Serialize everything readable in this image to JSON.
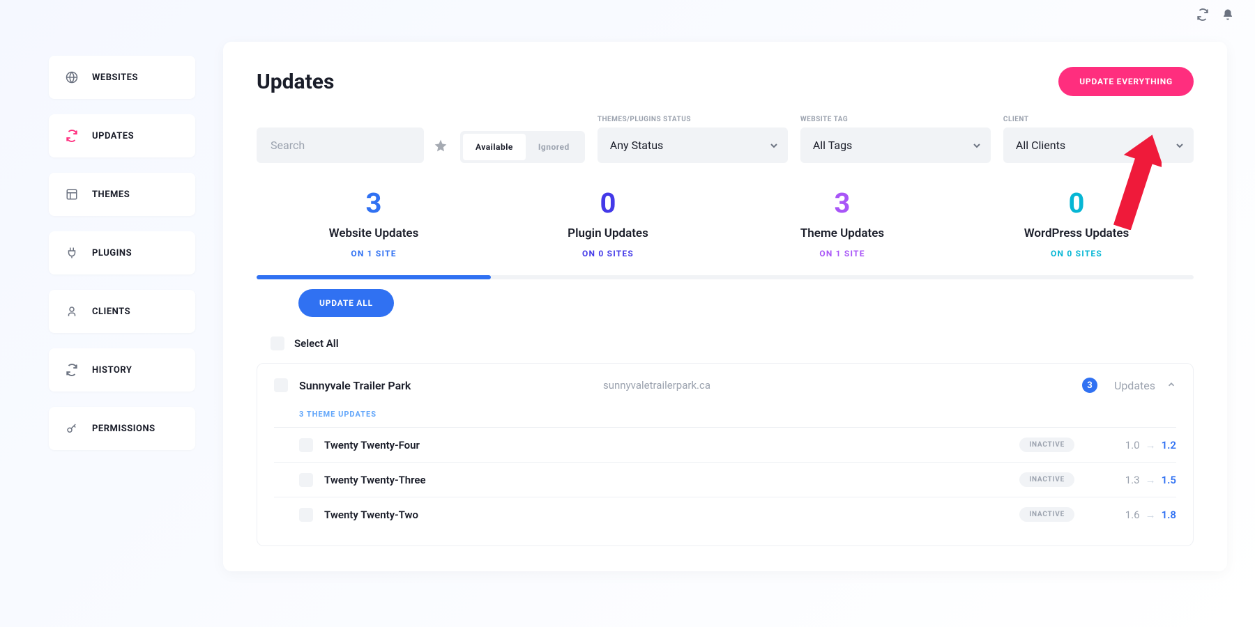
{
  "topbar": {
    "refresh_icon": "refresh",
    "bell_icon": "bell"
  },
  "sidebar": {
    "items": [
      {
        "label": "Websites",
        "icon": "globe"
      },
      {
        "label": "Updates",
        "icon": "refresh"
      },
      {
        "label": "Themes",
        "icon": "layout"
      },
      {
        "label": "Plugins",
        "icon": "plug"
      },
      {
        "label": "Clients",
        "icon": "user"
      },
      {
        "label": "History",
        "icon": "refresh"
      },
      {
        "label": "Permissions",
        "icon": "key"
      }
    ]
  },
  "page": {
    "title": "Updates"
  },
  "actions": {
    "update_everything": "Update Everything",
    "update_all": "Update All"
  },
  "filters": {
    "search_placeholder": "Search",
    "toggle": {
      "available": "Available",
      "ignored": "Ignored"
    },
    "status": {
      "label": "Themes/Plugins Status",
      "value": "Any Status"
    },
    "tag": {
      "label": "Website Tag",
      "value": "All Tags"
    },
    "client": {
      "label": "Client",
      "value": "All Clients"
    }
  },
  "stats": [
    {
      "count": "3",
      "title": "Website Updates",
      "sub": "On 1 Site",
      "color": "blue"
    },
    {
      "count": "0",
      "title": "Plugin Updates",
      "sub": "On 0 Sites",
      "color": "indigo"
    },
    {
      "count": "3",
      "title": "Theme Updates",
      "sub": "On 1 Site",
      "color": "purple"
    },
    {
      "count": "0",
      "title": "WordPress Updates",
      "sub": "On 0 Sites",
      "color": "cyan"
    }
  ],
  "list": {
    "select_all": "Select All",
    "site": {
      "name": "Sunnyvale Trailer Park",
      "url": "sunnyvaletrailerpark.ca",
      "count": "3",
      "updates_label": "Updates",
      "section_heading": "3 Theme Updates",
      "rows": [
        {
          "name": "Twenty Twenty-Four",
          "status": "Inactive",
          "from": "1.0",
          "to": "1.2"
        },
        {
          "name": "Twenty Twenty-Three",
          "status": "Inactive",
          "from": "1.3",
          "to": "1.5"
        },
        {
          "name": "Twenty Twenty-Two",
          "status": "Inactive",
          "from": "1.6",
          "to": "1.8"
        }
      ]
    }
  }
}
